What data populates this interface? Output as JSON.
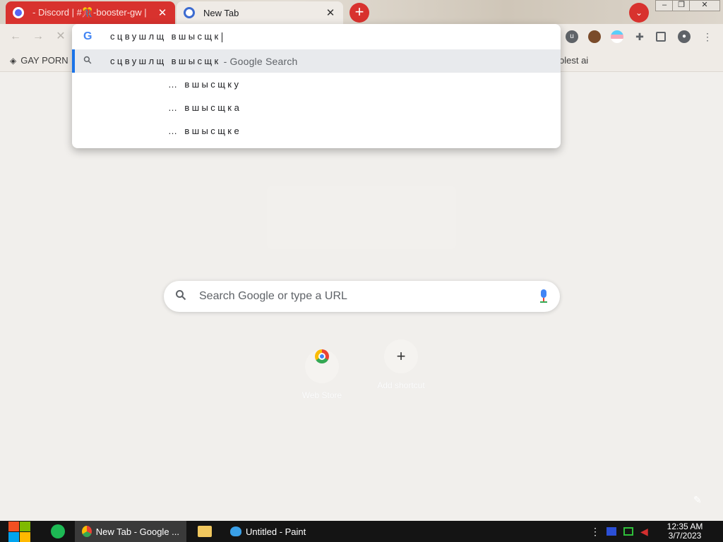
{
  "tabs": [
    {
      "title": "- Discord | #🎊-booster-gw |",
      "close": "✕"
    },
    {
      "title": "New Tab",
      "close": "✕"
    }
  ],
  "new_tab_symbol": "+",
  "tab_search_symbol": "⌄",
  "window_controls": {
    "minimize": "‒",
    "maximize": "❐",
    "close": "✕"
  },
  "bookmarks": [
    {
      "label": "GAY PORN"
    },
    {
      "label": "olest ai"
    }
  ],
  "omnibox": {
    "typed": "сцвушлщ вшысщк",
    "suggestions": [
      {
        "text": "сцвушлщ вшысщк",
        "suffix": "- Google Search",
        "icon": "search-icon",
        "selected": true
      },
      {
        "text": "… вшысщку",
        "icon": "",
        "selected": false
      },
      {
        "text": "… вшысщка",
        "icon": "",
        "selected": false
      },
      {
        "text": "… вшысщке",
        "icon": "",
        "selected": false
      }
    ]
  },
  "ntp": {
    "search_placeholder": "Search Google or type a URL",
    "shortcuts": [
      {
        "label": "Web Store",
        "icon": "chrome-web-store-icon"
      },
      {
        "label": "Add shortcut",
        "icon": "plus-icon",
        "symbol": "+"
      }
    ]
  },
  "taskbar": {
    "buttons": [
      {
        "label": "New Tab - Google ...",
        "active": true
      },
      {
        "label": "Untitled - Paint",
        "active": false
      }
    ],
    "clock_time": "12:35 AM",
    "clock_date": "3/7/2023"
  },
  "colors": {
    "tab_accent": "#d8322e",
    "selected_bar": "#1a73e8",
    "taskbar_bg": "#141414"
  }
}
